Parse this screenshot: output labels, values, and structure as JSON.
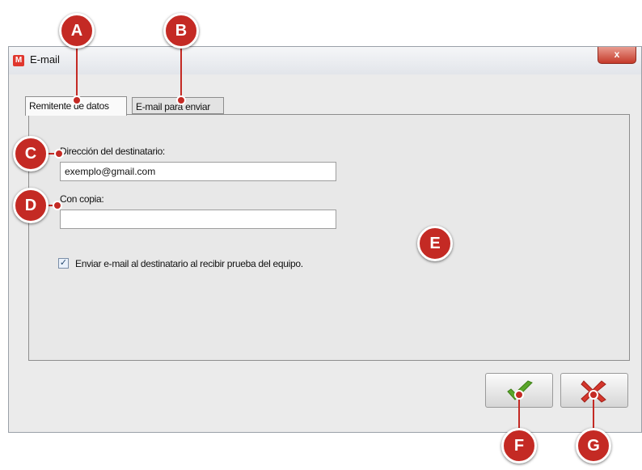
{
  "window": {
    "title": "E-mail",
    "app_icon_letter": "M",
    "close_glyph": "x",
    "tabs": [
      {
        "label": "Remitente de datos",
        "active": true
      },
      {
        "label": "E-mail para enviar",
        "active": false
      }
    ],
    "form": {
      "recipient_label": "Dirección del destinatario:",
      "recipient_value": "exemplo@gmail.com",
      "cc_label": "Con copia:",
      "cc_value": "",
      "send_on_receive_label": "Enviar e-mail al destinatario al recibir prueba del equipo.",
      "send_on_receive_checked": true
    },
    "buttons": {
      "confirm_icon": "green-check-icon",
      "cancel_icon": "red-x-icon"
    }
  },
  "callouts": [
    "A",
    "B",
    "C",
    "D",
    "E",
    "F",
    "G"
  ],
  "colors": {
    "callout_red": "#c42a24",
    "confirm_green": "#5aa62a",
    "cancel_red": "#d4362c"
  }
}
